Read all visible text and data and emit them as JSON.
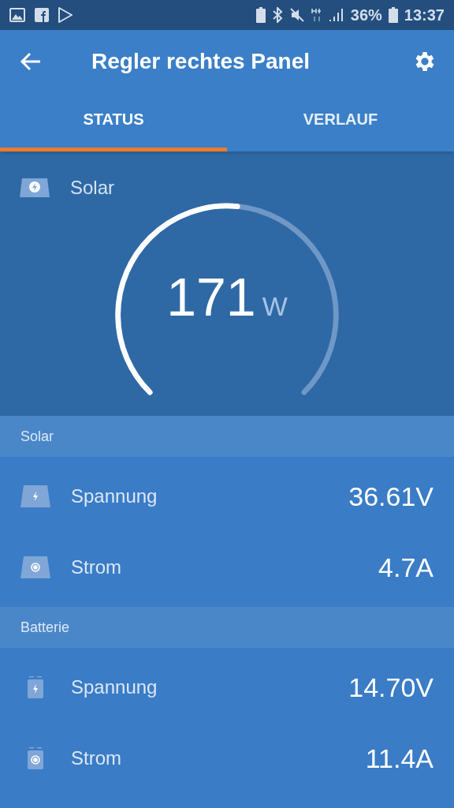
{
  "status_bar": {
    "battery": "36%",
    "time": "13:37"
  },
  "app_bar": {
    "title": "Regler rechtes Panel"
  },
  "tabs": [
    {
      "label": "STATUS",
      "selected": true
    },
    {
      "label": "VERLAUF",
      "selected": false
    }
  ],
  "gauge": {
    "label": "Solar",
    "value": "171",
    "unit": "W"
  },
  "sections": [
    {
      "title": "Solar",
      "kind": "solar",
      "rows": [
        {
          "kind": "voltage",
          "label": "Spannung",
          "value": "36.61V"
        },
        {
          "kind": "current",
          "label": "Strom",
          "value": "4.7A"
        }
      ]
    },
    {
      "title": "Batterie",
      "kind": "battery",
      "rows": [
        {
          "kind": "voltage",
          "label": "Spannung",
          "value": "14.70V"
        },
        {
          "kind": "current",
          "label": "Strom",
          "value": "11.4A"
        }
      ]
    }
  ]
}
